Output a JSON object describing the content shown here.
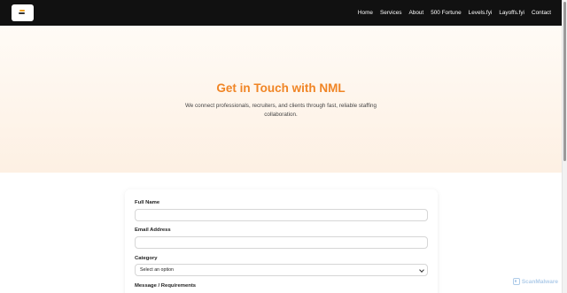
{
  "nav": {
    "links": [
      "Home",
      "Services",
      "About",
      "500 Fortune",
      "Levels.fyi",
      "Layoffs.fyi",
      "Contact"
    ]
  },
  "hero": {
    "title": "Get in Touch with NML",
    "subtitle": "We connect professionals, recruiters, and clients through fast, reliable staffing collaboration."
  },
  "form": {
    "full_name_label": "Full Name",
    "full_name_value": "",
    "email_label": "Email Address",
    "email_value": "",
    "category_label": "Category",
    "category_selected": "Select an option",
    "message_label": "Message / Requirements"
  },
  "watermark": {
    "text": "ScanMalware"
  },
  "colors": {
    "nav_bg": "#111111",
    "accent": "#f08525",
    "hero_bg_top": "#fffbf6",
    "hero_bg_bottom": "#fdf0e3"
  }
}
